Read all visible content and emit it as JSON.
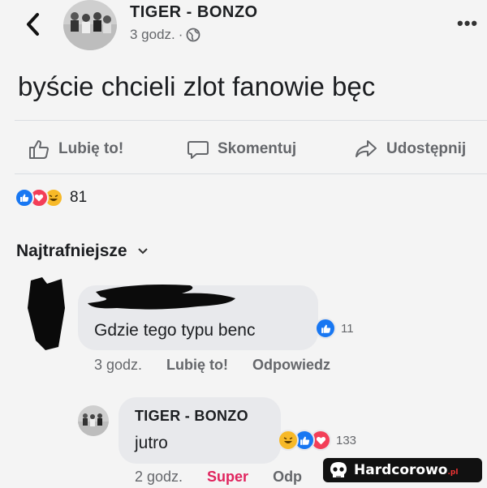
{
  "post": {
    "author": "TIGER - BONZO",
    "time": "3 godz.",
    "separator": "·",
    "text": "byście chcieli zlot fanowie bęc"
  },
  "actions": {
    "like": "Lubię to!",
    "comment": "Skomentuj",
    "share": "Udostępnij"
  },
  "reactions": {
    "icons": [
      "like-icon",
      "love-icon",
      "haha-icon"
    ],
    "count": "81"
  },
  "sort": {
    "label": "Najtrafniejsze"
  },
  "comments": [
    {
      "author": "",
      "text": "Gdzie tego typu benc",
      "reaction_count": "11",
      "time": "3 godz.",
      "like": "Lubię to!",
      "reply": "Odpowiedz"
    },
    {
      "author": "TIGER - BONZO",
      "text": "jutro",
      "reaction_count": "133",
      "time": "2 godz.",
      "like": "Super",
      "reply": "Odp"
    }
  ],
  "watermark": {
    "text": "Hardcorowo",
    "suffix": ".pl"
  },
  "colors": {
    "like_blue": "#1877f2",
    "love_red": "#f33e58",
    "haha_yellow": "#f7b928",
    "super_pink": "#e0245e"
  }
}
